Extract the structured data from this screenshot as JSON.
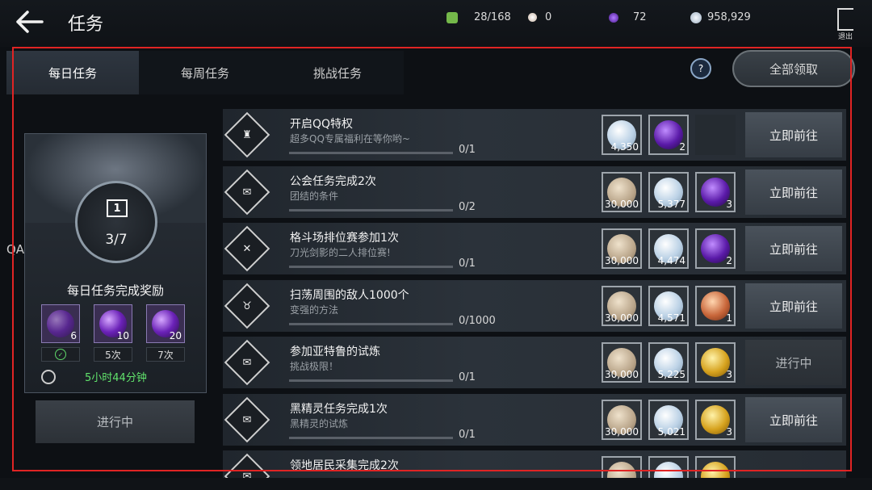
{
  "header": {
    "title": "任务",
    "resources": [
      {
        "icon": "stamina-icon",
        "value": "28/168",
        "color": "#74b84a"
      },
      {
        "icon": "pearl-icon",
        "value": "0",
        "color": "#e8d8c8"
      },
      {
        "icon": "purple-gem-icon",
        "value": "72",
        "color": "#7a3cd0"
      },
      {
        "icon": "silver-coin-icon",
        "value": "958,929",
        "color": "#c0ccd8"
      }
    ],
    "exit_label": "退出"
  },
  "side_label": "QA",
  "tabs": [
    "每日任务",
    "每周任务",
    "挑战任务"
  ],
  "help_label": "?",
  "claim_all_label": "全部领取",
  "daily_reward": {
    "progress": "3/7",
    "title": "每日任务完成奖励",
    "orbs": [
      {
        "count": "6",
        "label": "",
        "done": true
      },
      {
        "count": "10",
        "label": "5次",
        "done": false
      },
      {
        "count": "20",
        "label": "7次",
        "done": false
      }
    ],
    "timer": "5小时44分钟",
    "status_label": "进行中"
  },
  "tasks": [
    {
      "title": "开启QQ特权",
      "subtitle": "超多QQ专属福利在等你哟~",
      "progress": "0/1",
      "icon": "crown-icon",
      "rewards": [
        {
          "type": "silver",
          "count": "4,350"
        },
        {
          "type": "purple-gem",
          "count": "2"
        },
        {
          "type": "empty",
          "count": ""
        }
      ],
      "action": "立即前往"
    },
    {
      "title": "公会任务完成2次",
      "subtitle": "团结的条件",
      "progress": "0/2",
      "icon": "guild-scroll-icon",
      "rewards": [
        {
          "type": "exp",
          "count": "30,000"
        },
        {
          "type": "silver",
          "count": "5,377"
        },
        {
          "type": "purple-gem",
          "count": "3"
        }
      ],
      "action": "立即前往"
    },
    {
      "title": "格斗场排位赛参加1次",
      "subtitle": "刀光剑影的二人排位赛!",
      "progress": "0/1",
      "icon": "crossed-swords-icon",
      "rewards": [
        {
          "type": "exp",
          "count": "30,000"
        },
        {
          "type": "silver",
          "count": "4,474"
        },
        {
          "type": "purple-gem",
          "count": "2"
        }
      ],
      "action": "立即前往"
    },
    {
      "title": "扫荡周围的敌人1000个",
      "subtitle": "变强的方法",
      "progress": "0/1000",
      "icon": "horned-helmet-icon",
      "rewards": [
        {
          "type": "exp",
          "count": "30,000"
        },
        {
          "type": "silver",
          "count": "4,571"
        },
        {
          "type": "bronze-medal",
          "count": "1"
        }
      ],
      "action": "立即前往"
    },
    {
      "title": "参加亚特鲁的试炼",
      "subtitle": "挑战极限！",
      "progress": "0/1",
      "icon": "guild-scroll-icon",
      "rewards": [
        {
          "type": "exp",
          "count": "30,000"
        },
        {
          "type": "silver",
          "count": "5,225"
        },
        {
          "type": "gold-medal",
          "count": "3"
        }
      ],
      "action": "进行中"
    },
    {
      "title": "黑精灵任务完成1次",
      "subtitle": "黑精灵的试炼",
      "progress": "0/1",
      "icon": "guild-scroll-icon",
      "rewards": [
        {
          "type": "exp",
          "count": "30,000"
        },
        {
          "type": "silver",
          "count": "5,021"
        },
        {
          "type": "gold-medal",
          "count": "3"
        }
      ],
      "action": "立即前往"
    },
    {
      "title": "领地居民采集完成2次",
      "subtitle": "",
      "progress": "",
      "icon": "guild-scroll-icon",
      "rewards": [
        {
          "type": "exp",
          "count": ""
        },
        {
          "type": "silver",
          "count": ""
        },
        {
          "type": "gold-medal",
          "count": ""
        }
      ],
      "action": ""
    }
  ],
  "colors": {
    "accent_green": "#61e36c",
    "highlight_red": "#e02424"
  }
}
